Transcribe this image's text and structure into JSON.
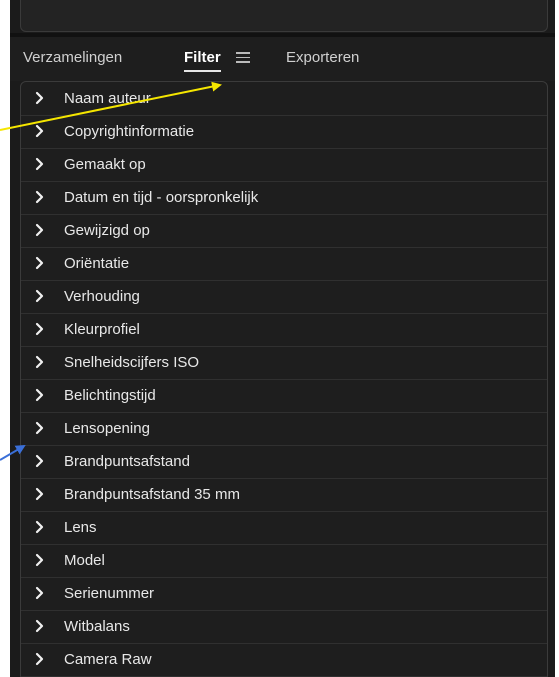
{
  "tabs": {
    "collections": "Verzamelingen",
    "filter": "Filter",
    "export": "Exporteren"
  },
  "filters": [
    "Naam auteur",
    "Copyrightinformatie",
    "Gemaakt op",
    "Datum en tijd - oorspronkelijk",
    "Gewijzigd op",
    "Oriëntatie",
    "Verhouding",
    "Kleurprofiel",
    "Snelheidscijfers ISO",
    "Belichtingstijd",
    "Lensopening",
    "Brandpuntsafstand",
    "Brandpuntsafstand 35 mm",
    "Lens",
    "Model",
    "Serienummer",
    "Witbalans",
    "Camera Raw"
  ],
  "icons": {
    "row": "chevron-right-icon",
    "menu": "hamburger-menu-icon"
  },
  "colors": {
    "background": "#1b1b1b",
    "text": "#e8e8e8",
    "annotation_yellow": "#f5e600",
    "annotation_blue": "#3a6fd8"
  }
}
